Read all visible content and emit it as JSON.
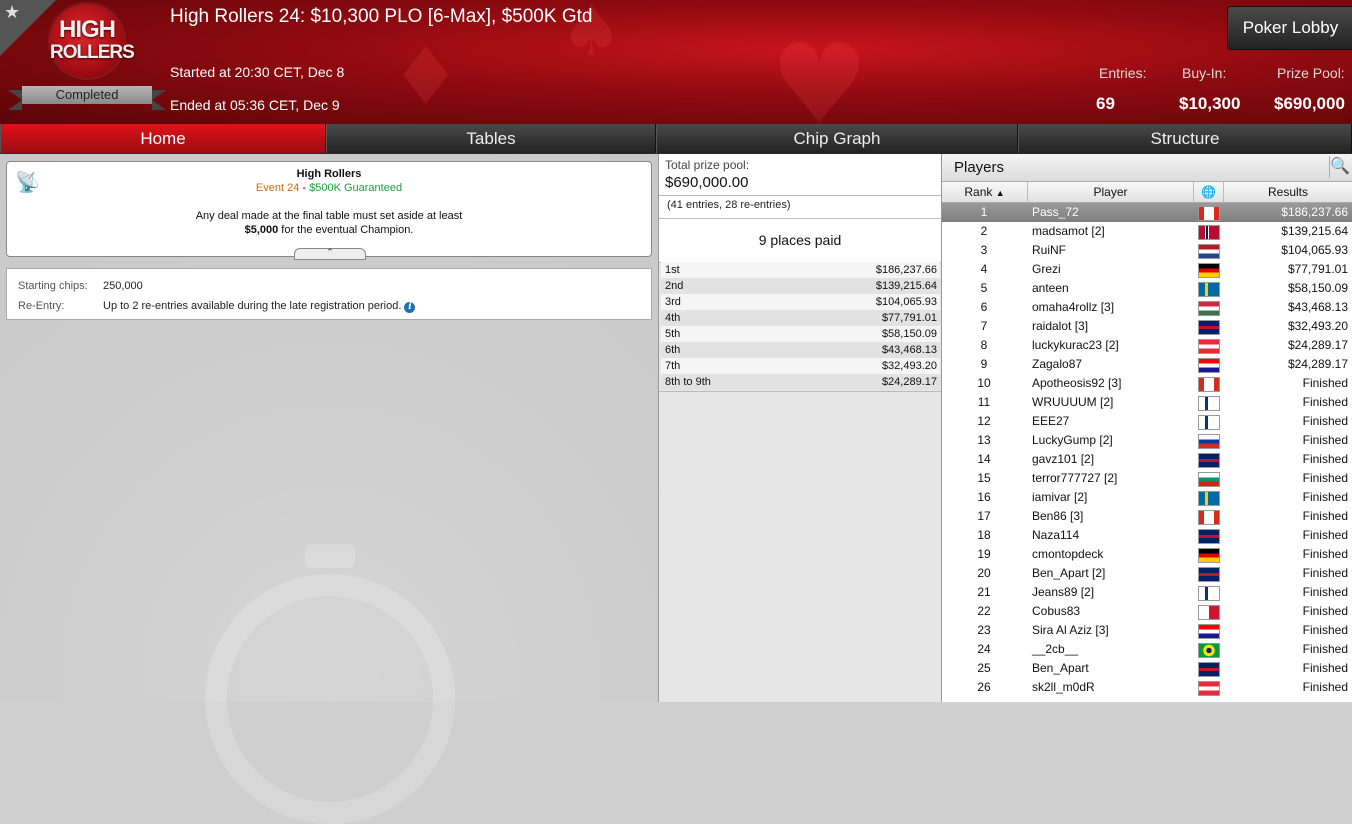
{
  "header": {
    "logo_line1": "HIGH",
    "logo_line2": "ROLLERS",
    "status": "Completed",
    "title": "High Rollers 24: $10,300 PLO [6-Max], $500K Gtd",
    "started": "Started at 20:30 CET, Dec 8",
    "ended": "Ended at 05:36 CET, Dec 9",
    "lobby_button": "Poker Lobby",
    "entries_label": "Entries:",
    "entries_value": "69",
    "buyin_label": "Buy-In:",
    "buyin_value": "$10,300",
    "prizepool_label": "Prize Pool:",
    "prizepool_value": "$690,000",
    "star_icon": "star-icon"
  },
  "tabs": [
    {
      "label": "Home",
      "active": true
    },
    {
      "label": "Tables",
      "active": false
    },
    {
      "label": "Chip Graph",
      "active": false
    },
    {
      "label": "Structure",
      "active": false
    }
  ],
  "notice": {
    "title": "High Rollers",
    "event": "Event 24",
    "dash": " - ",
    "guarantee": "$500K Guaranteed",
    "text1": "Any deal made at the final table must set aside at least",
    "amount": "$5,000",
    "text2": " for the eventual Champion.",
    "icon": "antenna-icon"
  },
  "info": {
    "chips_label": "Starting chips:",
    "chips_value": "250,000",
    "reentry_label": "Re-Entry:",
    "reentry_value": "Up to 2 re-entries available during the late registration period."
  },
  "prize": {
    "total_label": "Total prize pool:",
    "total_value": "$690,000.00",
    "entries_text": "(41 entries, 28 re-entries)",
    "paid_text": "9 places paid",
    "rows": [
      {
        "place": "1st",
        "amount": "$186,237.66"
      },
      {
        "place": "2nd",
        "amount": "$139,215.64"
      },
      {
        "place": "3rd",
        "amount": "$104,065.93"
      },
      {
        "place": "4th",
        "amount": "$77,791.01"
      },
      {
        "place": "5th",
        "amount": "$58,150.09"
      },
      {
        "place": "6th",
        "amount": "$43,468.13"
      },
      {
        "place": "7th",
        "amount": "$32,493.20"
      },
      {
        "place": "8th to 9th",
        "amount": "$24,289.17"
      }
    ]
  },
  "players": {
    "title": "Players",
    "col_rank": "Rank",
    "col_player": "Player",
    "col_results": "Results",
    "rows": [
      {
        "rank": "1",
        "name": "Pass_72",
        "flag": "ca",
        "result": "$186,237.66"
      },
      {
        "rank": "2",
        "name": "madsamot [2]",
        "flag": "no",
        "result": "$139,215.64"
      },
      {
        "rank": "3",
        "name": "RuiNF",
        "flag": "nl",
        "result": "$104,065.93"
      },
      {
        "rank": "4",
        "name": "Grezi",
        "flag": "de",
        "result": "$77,791.01"
      },
      {
        "rank": "5",
        "name": "anteen",
        "flag": "se",
        "result": "$58,150.09"
      },
      {
        "rank": "6",
        "name": "omaha4rollz [3]",
        "flag": "hu",
        "result": "$43,468.13"
      },
      {
        "rank": "7",
        "name": "raidalot [3]",
        "flag": "gb",
        "result": "$32,493.20"
      },
      {
        "rank": "8",
        "name": "luckykurac23 [2]",
        "flag": "at",
        "result": "$24,289.17"
      },
      {
        "rank": "9",
        "name": "Zagalo87",
        "flag": "hr",
        "result": "$24,289.17"
      },
      {
        "rank": "10",
        "name": "Apotheosis92 [3]",
        "flag": "ca",
        "result": "Finished"
      },
      {
        "rank": "11",
        "name": "WRUUUUM [2]",
        "flag": "fi",
        "result": "Finished"
      },
      {
        "rank": "12",
        "name": "EEE27",
        "flag": "fi",
        "result": "Finished"
      },
      {
        "rank": "13",
        "name": "LuckyGump [2]",
        "flag": "ru",
        "result": "Finished"
      },
      {
        "rank": "14",
        "name": "gavz101 [2]",
        "flag": "gb",
        "result": "Finished"
      },
      {
        "rank": "15",
        "name": "terror777727 [2]",
        "flag": "bg",
        "result": "Finished"
      },
      {
        "rank": "16",
        "name": "iamivar [2]",
        "flag": "se",
        "result": "Finished"
      },
      {
        "rank": "17",
        "name": "Ben86 [3]",
        "flag": "ca",
        "result": "Finished"
      },
      {
        "rank": "18",
        "name": "Naza114",
        "flag": "gb",
        "result": "Finished"
      },
      {
        "rank": "19",
        "name": "cmontopdeck",
        "flag": "de",
        "result": "Finished"
      },
      {
        "rank": "20",
        "name": "Ben_Apart [2]",
        "flag": "gb",
        "result": "Finished"
      },
      {
        "rank": "21",
        "name": "Jeans89 [2]",
        "flag": "fi",
        "result": "Finished"
      },
      {
        "rank": "22",
        "name": "Cobus83",
        "flag": "mt",
        "result": "Finished"
      },
      {
        "rank": "23",
        "name": "Sira Al Aziz [3]",
        "flag": "hr",
        "result": "Finished"
      },
      {
        "rank": "24",
        "name": "__2cb__",
        "flag": "br",
        "result": "Finished"
      },
      {
        "rank": "25",
        "name": "Ben_Apart",
        "flag": "gb",
        "result": "Finished"
      },
      {
        "rank": "26",
        "name": "sk2ll_m0dR",
        "flag": "at",
        "result": "Finished"
      }
    ]
  }
}
